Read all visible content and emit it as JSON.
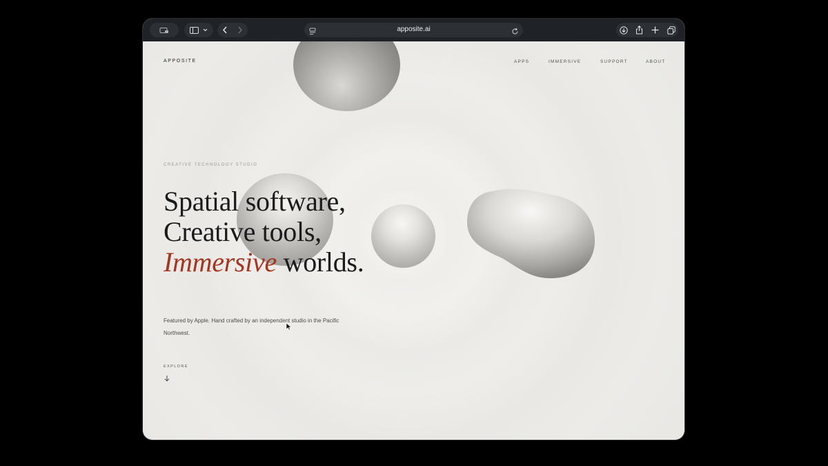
{
  "browser": {
    "url": "apposite.ai",
    "icons": [
      "page-settings-icon",
      "sidebar-icon",
      "chevron-down-icon",
      "back-icon",
      "forward-icon",
      "reader-icon",
      "reload-icon",
      "download-icon",
      "share-icon",
      "new-tab-icon",
      "tab-overview-icon"
    ]
  },
  "site": {
    "logo": "APPOSITE",
    "nav": [
      "APPS",
      "IMMERSIVE",
      "SUPPORT",
      "ABOUT"
    ],
    "eyebrow": "CREATIVE TECHNOLOGY STUDIO",
    "headline": {
      "line1": "Spatial software,",
      "line2": "Creative tools,",
      "line3_accent": "Immersive",
      "line3_rest": " worlds."
    },
    "description": "Featured by Apple. Hand crafted by an independent studio in the Pacific Northwest.",
    "explore": "EXPLORE"
  },
  "colors": {
    "accent": "#a43520",
    "page_background": "#ecebe8",
    "toolbar": "#1f2226"
  }
}
